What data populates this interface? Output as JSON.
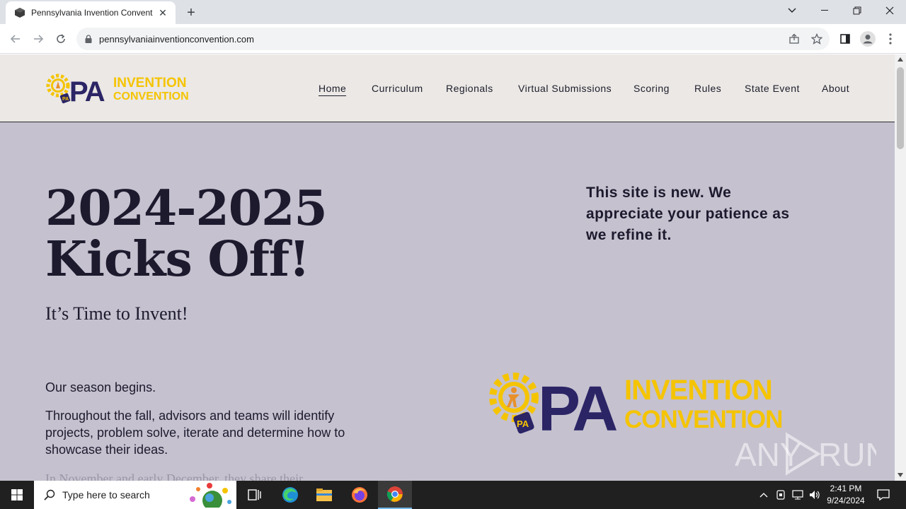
{
  "browser": {
    "tab_title": "Pennsylvania Invention Convent",
    "url": "pennsylvaniainventionconvention.com"
  },
  "site": {
    "logo": {
      "pa": "PA",
      "line1": "INVENTION",
      "line2": "CONVENTION",
      "badge": "PA"
    },
    "nav": [
      "Home",
      "Curriculum",
      "Regionals",
      "Virtual Submissions",
      "Scoring",
      "Rules",
      "State Event",
      "About"
    ],
    "active_nav": "Home"
  },
  "hero": {
    "title": "2024-2025 Kicks Off!",
    "subtitle": "It’s Time to Invent!",
    "notice": "This site is new. We appreciate your patience as we refine it.",
    "para1": "Our season begins.",
    "para2": "Throughout the fall, advisors and teams will identify projects, problem solve, iterate and determine how to showcase their ideas.",
    "para3": "In November and early December, they share their"
  },
  "watermark": {
    "left": "ANY",
    "right": "RUN"
  },
  "taskbar": {
    "search_placeholder": "Type here to search",
    "time": "2:41 PM",
    "date": "9/24/2024"
  },
  "colors": {
    "page_bg": "#c5c1cf",
    "header_bg": "#ebe8e5",
    "brand_navy": "#2b2566",
    "brand_yellow": "#f5c400",
    "text_dark": "#1d1a2e"
  },
  "icons": [
    "back-arrow-icon",
    "forward-arrow-icon",
    "reload-icon",
    "lock-icon",
    "share-icon",
    "star-icon",
    "side-panel-icon",
    "profile-icon",
    "menu-dots-icon",
    "windows-start-icon",
    "search-icon",
    "task-view-icon",
    "edge-icon",
    "file-explorer-icon",
    "firefox-icon",
    "chrome-icon"
  ]
}
